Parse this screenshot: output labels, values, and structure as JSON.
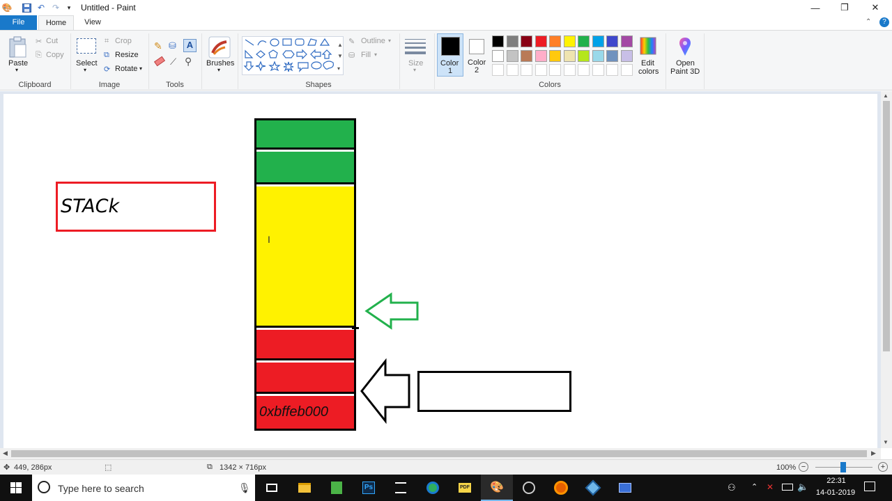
{
  "window": {
    "title": "Untitled - Paint",
    "minimize": "—",
    "restore": "❐",
    "close": "✕"
  },
  "tabs": {
    "file": "File",
    "home": "Home",
    "view": "View"
  },
  "ribbon": {
    "clipboard": {
      "paste": "Paste",
      "cut": "Cut",
      "copy": "Copy",
      "group": "Clipboard"
    },
    "image": {
      "select": "Select",
      "crop": "Crop",
      "resize": "Resize",
      "rotate": "Rotate",
      "group": "Image"
    },
    "tools": {
      "group": "Tools"
    },
    "brushes": {
      "label": "Brushes"
    },
    "shapes": {
      "outline": "Outline",
      "fill": "Fill",
      "group": "Shapes"
    },
    "size": {
      "label": "Size"
    },
    "colors": {
      "color1_line1": "Color",
      "color1_line2": "1",
      "color2_line1": "Color",
      "color2_line2": "2",
      "edit_line1": "Edit",
      "edit_line2": "colors",
      "group": "Colors",
      "palette_row1": [
        "#000000",
        "#7f7f7f",
        "#880015",
        "#ed1c24",
        "#ff7f27",
        "#fff200",
        "#22b14c",
        "#00a2e8",
        "#3f48cc",
        "#a349a4"
      ],
      "palette_row2": [
        "#ffffff",
        "#c3c3c3",
        "#b97a57",
        "#ffaec9",
        "#ffc90e",
        "#efe4b0",
        "#b5e61d",
        "#99d9ea",
        "#7092be",
        "#c8bfe7"
      ]
    },
    "paint3d": {
      "line1": "Open",
      "line2": "Paint 3D"
    }
  },
  "drawing": {
    "stack_label": "STACk",
    "address_label": "0xbffeb000",
    "colors": {
      "green": "#22b14c",
      "yellow": "#fff200",
      "red": "#ed1c24",
      "label_border": "#ed1c24"
    }
  },
  "status": {
    "cursor_pos": "449, 286px",
    "canvas_size": "1342 × 716px",
    "zoom": "100%"
  },
  "taskbar": {
    "search_placeholder": "Type here to search",
    "time": "22:31",
    "date": "14-01-2019"
  }
}
